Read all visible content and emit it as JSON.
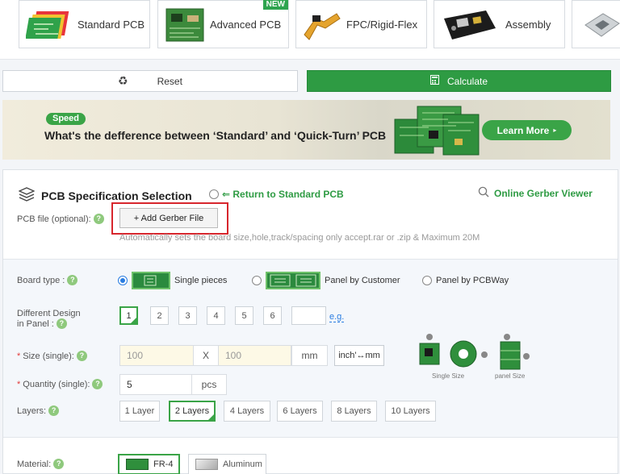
{
  "product_tabs": [
    {
      "label": "Standard PCB",
      "icon": "pcb-stack-icon"
    },
    {
      "label": "Advanced PCB",
      "icon": "advanced-pcb-icon",
      "badge": "NEW"
    },
    {
      "label": "FPC/Rigid-Flex",
      "icon": "flex-pcb-icon"
    },
    {
      "label": "Assembly",
      "icon": "assembly-board-icon"
    },
    {
      "label": "",
      "icon": "stencil-icon"
    }
  ],
  "actions": {
    "reset_label": "Reset",
    "calculate_label": "Calculate"
  },
  "banner": {
    "pill": "Speed",
    "title": "What's the defference between ‘Standard’ and ‘Quick-Turn’ PCB",
    "learn_more": "Learn More"
  },
  "spec": {
    "title": "PCB Specification Selection",
    "return_link": "⇐ Return to Standard PCB",
    "gerber_viewer": "Online Gerber Viewer",
    "pcb_file_label": "PCB file (optional):",
    "add_gerber": "+ Add Gerber File",
    "hint": "Automatically sets the board size,hole,track/spacing only accept.rar or .zip & Maximum 20M"
  },
  "board_type": {
    "label": "Board type :",
    "options": [
      "Single pieces",
      "Panel by Customer",
      "Panel by PCBWay"
    ],
    "selected": "Single pieces"
  },
  "different_design": {
    "label_line1": "Different Design",
    "label_line2": "in Panel :",
    "options": [
      "1",
      "2",
      "3",
      "4",
      "5",
      "6"
    ],
    "selected": "1",
    "eg": "e.g."
  },
  "size": {
    "label": "Size (single):",
    "width": "100",
    "x": "X",
    "height": "100",
    "unit": "mm",
    "unit_toggle": "inch'↔mm",
    "diagram_caption_single": "Single Size",
    "diagram_caption_panel": "panel Size"
  },
  "quantity": {
    "label": "Quantity (single):",
    "value": "5",
    "unit": "pcs"
  },
  "layers": {
    "label": "Layers:",
    "options": [
      "1 Layer",
      "2 Layers",
      "4 Layers",
      "6 Layers",
      "8 Layers",
      "10 Layers"
    ],
    "selected": "2 Layers"
  },
  "material": {
    "label": "Material:",
    "options": [
      "FR-4",
      "Aluminum"
    ],
    "selected": "FR-4"
  },
  "colors": {
    "accent": "#2e9b43",
    "highlight": "#d7262d",
    "link": "#2a7de1"
  }
}
